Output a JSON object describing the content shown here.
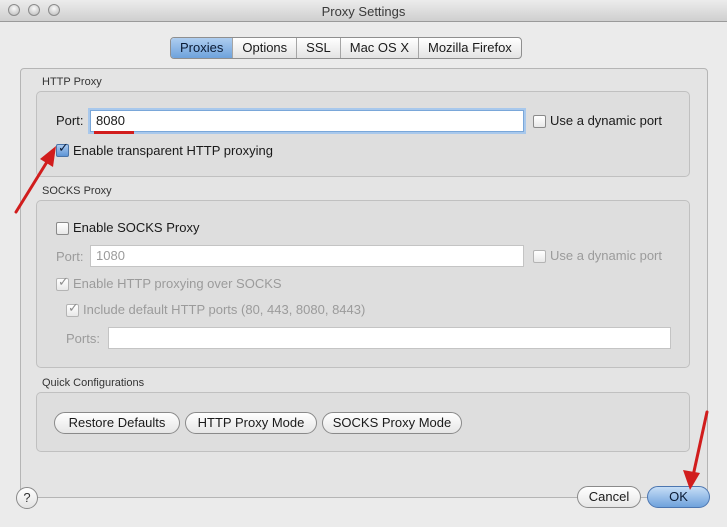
{
  "window": {
    "title": "Proxy Settings"
  },
  "tabs": [
    {
      "label": "Proxies",
      "active": true
    },
    {
      "label": "Options",
      "active": false
    },
    {
      "label": "SSL",
      "active": false
    },
    {
      "label": "Mac OS X",
      "active": false
    },
    {
      "label": "Mozilla Firefox",
      "active": false
    }
  ],
  "http_proxy": {
    "section_label": "HTTP Proxy",
    "port_label": "Port:",
    "port_value": "8080",
    "dynamic_port_label": "Use a dynamic port",
    "dynamic_port_checked": false,
    "transparent_label": "Enable transparent HTTP proxying",
    "transparent_checked": true
  },
  "socks_proxy": {
    "section_label": "SOCKS Proxy",
    "enable_label": "Enable SOCKS Proxy",
    "enable_checked": false,
    "port_label": "Port:",
    "port_value": "1080",
    "dynamic_port_label": "Use a dynamic port",
    "http_over_socks_label": "Enable HTTP proxying over SOCKS",
    "http_over_socks_checked": true,
    "include_ports_label": "Include default HTTP ports (80, 443, 8080, 8443)",
    "include_ports_checked": true,
    "ports_label": "Ports:",
    "ports_value": ""
  },
  "quick_config": {
    "section_label": "Quick Configurations",
    "restore_label": "Restore Defaults",
    "http_mode_label": "HTTP Proxy Mode",
    "socks_mode_label": "SOCKS Proxy Mode"
  },
  "footer": {
    "help_label": "?",
    "cancel_label": "Cancel",
    "ok_label": "OK"
  },
  "colors": {
    "annotation_arrow": "#d11d1d",
    "selection_accent": "#6ea2dc"
  }
}
